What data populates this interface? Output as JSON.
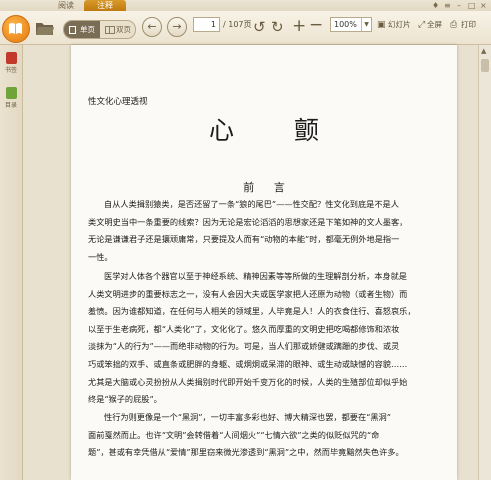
{
  "tabs": [
    {
      "label": "阅读"
    },
    {
      "label": "注释"
    }
  ],
  "toolbar": {
    "view_single": "单页",
    "view_double": "双页",
    "current_page": "1",
    "total_pages": "/ 107页",
    "zoom": "100%",
    "slideshow": "幻灯片",
    "fullscreen": "全屏",
    "print": "打印"
  },
  "sidebar": {
    "items": [
      {
        "label": "书签"
      },
      {
        "label": "目录"
      }
    ]
  },
  "book": {
    "running_head": "性文化心理透视",
    "title": "心 颤",
    "section_heading": "前 言",
    "paragraphs": [
      [
        "自从人类揖别猿类，是否还留了一条“狼的尾巴”——性交配？性文化到底是不是人",
        "类文明史当中一条重要的线索？因为无论是宏论滔滔的思想家还是下笔如神的文人墨客，",
        "无论是谦谦君子还是攘顽庸常，只要提及人而有“动物的本能”时，都毫无例外地是指一",
        "一性。"
      ],
      [
        "医学对人体各个器官以至于神经系统、精神因素等等所做的生理解剖分析，本身就是",
        "人类文明进步的重要标志之一，没有人会因大夫或医学家把人还原为动物（或者生物）而",
        "羞愤。因为谁都知道，在任何与人相关的领域里，人毕竟是人！人的衣食住行、喜怒哀乐，",
        "以至于生老病死，都“人类化”了，文化化了。悠久而厚重的文明史把吃喝都修饰和浓妆",
        "淡抹为“人的行为”——而绝非动物的行为。可是，当人们那或娇健或蹒跚的步伐、或灵",
        "巧或笨拙的双手、或直条或肥胖的身躯、或炯炯或呆滞的眼神、或生动或缺憾的容貌……",
        "尤其是大脑或心灵扮扮从人类揖别时代即开始千变万化的时候，人类的生殖部位却似乎始",
        "终是“猴子的屁股”。"
      ],
      [
        "性行为则更像是一个“黑洞”，一切丰富多彩也好、博大精深也罢，都要在“黑洞”",
        "面前戛然而止。也许“文明”会转借着“人间烟火”“七情六欲”之类的似贬似咒的“命",
        "题”，甚或有幸凭借从“爱情”那里窃来微光渗透到“黑洞”之中，然而毕竟黯然失色许多。"
      ]
    ]
  }
}
